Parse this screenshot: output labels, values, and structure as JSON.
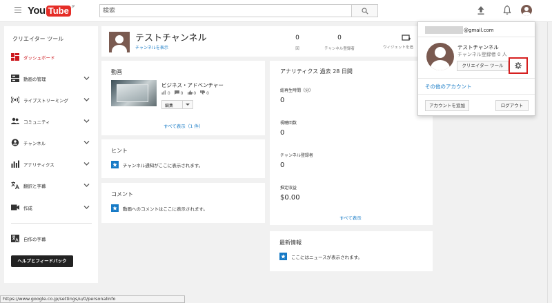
{
  "header": {
    "logo_you": "You",
    "logo_tube": "Tube",
    "logo_region": "JP",
    "search_placeholder": "検索"
  },
  "sidebar": {
    "title": "クリエイター ツール",
    "items": [
      {
        "label": "ダッシュボード",
        "icon": "dashboard-icon",
        "active": true
      },
      {
        "label": "動画の管理",
        "icon": "video-manager-icon"
      },
      {
        "label": "ライブストリーミング",
        "icon": "live-icon"
      },
      {
        "label": "コミュニティ",
        "icon": "community-icon"
      },
      {
        "label": "チャンネル",
        "icon": "channel-icon"
      },
      {
        "label": "アナリティクス",
        "icon": "analytics-icon"
      },
      {
        "label": "翻訳と字幕",
        "icon": "translate-icon"
      },
      {
        "label": "作成",
        "icon": "create-icon"
      },
      {
        "label": "自作の字幕",
        "icon": "subtitles-icon"
      }
    ],
    "help_button": "ヘルプとフィードバック"
  },
  "channel": {
    "name": "テストチャンネル",
    "view_link": "チャンネルを表示",
    "stats": [
      {
        "value": "0",
        "label": "回"
      },
      {
        "value": "0",
        "label": "チャンネル登録者"
      }
    ],
    "widget_label": "ウィジェットを追"
  },
  "videos": {
    "title": "動画",
    "item_title": "ビジネス・アドベンチャー",
    "views": "0",
    "comments": "0",
    "likes": "0",
    "dislikes": "0",
    "edit_label": "編集",
    "see_all": "すべて表示（1 件）"
  },
  "hints": {
    "title": "ヒント",
    "message": "チャンネル通知がここに表示されます。"
  },
  "comments": {
    "title": "コメント",
    "message": "動画へのコメントはここに表示されます。"
  },
  "analytics": {
    "title": "アナリティクス 過去 28 日間",
    "metrics": [
      {
        "label": "総再生時間（分）",
        "value": "0"
      },
      {
        "label": "視聴回数",
        "value": "0"
      },
      {
        "label": "チャンネル登録者",
        "value": "0"
      },
      {
        "label": "推定収益",
        "value": "$0.00"
      }
    ],
    "see_all": "すべて表示"
  },
  "news": {
    "title": "最新情報",
    "message": "ここにはニュースが表示されます。"
  },
  "account_menu": {
    "email": "@gmail.com",
    "channel_name": "テストチャンネル",
    "subscribers": "チャンネル登録者 0 人",
    "creator_tools": "クリエイター ツール",
    "other_accounts": "その他のアカウント",
    "add_account": "アカウントを追加",
    "logout": "ログアウト"
  },
  "status_bar": {
    "url": "https://www.google.co.jp/settings/u/0/personalinfo"
  },
  "colors": {
    "brand_red": "#e52d27",
    "link_blue": "#167ac6",
    "highlight_red": "#d62020"
  }
}
